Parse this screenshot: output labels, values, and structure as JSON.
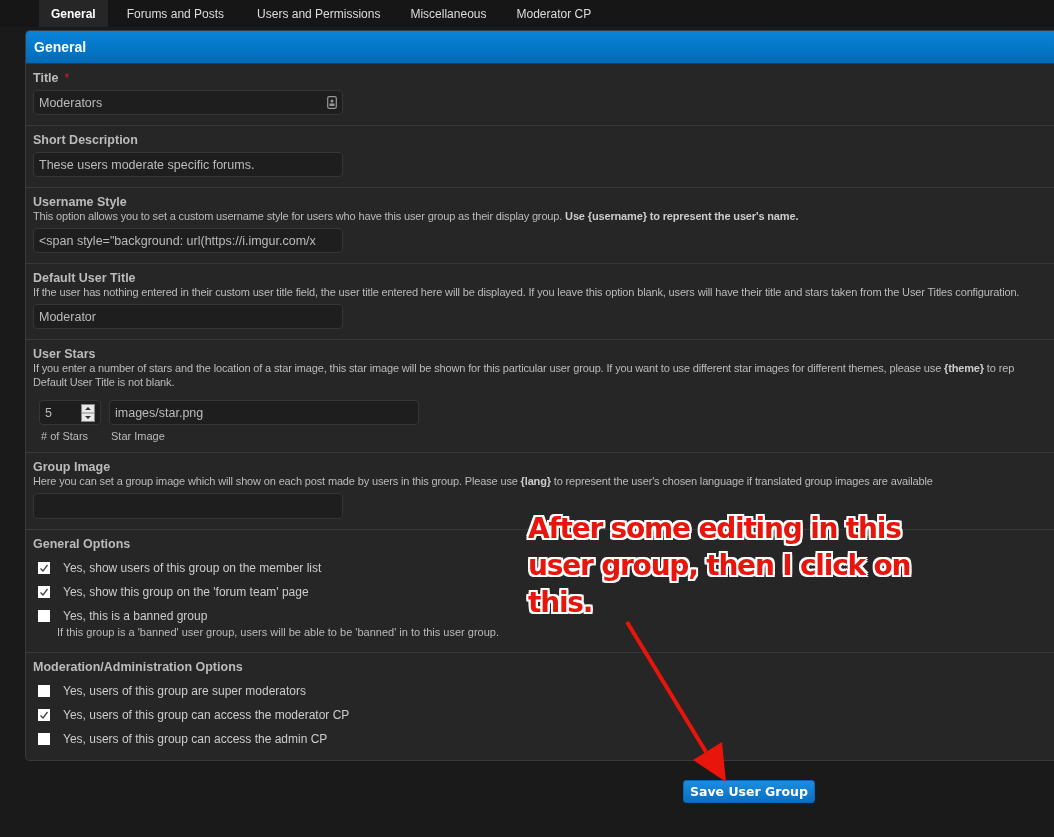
{
  "tabs": [
    {
      "label": "General",
      "selected": true
    },
    {
      "label": "Forums and Posts",
      "selected": false
    },
    {
      "label": "Users and Permissions",
      "selected": false
    },
    {
      "label": "Miscellaneous",
      "selected": false
    },
    {
      "label": "Moderator CP",
      "selected": false
    }
  ],
  "panel": {
    "title": "General",
    "rows": [
      {
        "kind": "text",
        "label": "Title",
        "required_mark": "*",
        "value": "Moderators",
        "field_icon": true
      },
      {
        "kind": "text",
        "label": "Short Description",
        "value": "These users moderate specific forums."
      },
      {
        "kind": "text",
        "label": "Username Style",
        "description": [
          "This option allows you to set a custom username style for users who have this user group as their display group. **Use {username} to represent the user's name.**"
        ],
        "value": "<span style=\"background: url(https://i.imgur.com/x"
      },
      {
        "kind": "text",
        "label": "Default User Title",
        "description": [
          "If the user has nothing entered in their custom user title field, the user title entered here will be displayed. If you leave this option blank, users will have their title and stars taken from the User Titles configuration."
        ],
        "value": "Moderator"
      },
      {
        "kind": "stars",
        "label": "User Stars",
        "description": [
          "If you enter a number of stars and the location of a star image, this star image will be shown for this particular user group. If you want to use different star images for different themes, please use **{theme}** to rep",
          "Default User Title is not blank."
        ],
        "count": "5",
        "count_label": "# of Stars",
        "image": "images/star.png",
        "image_label": "Star Image"
      },
      {
        "kind": "text",
        "label": "Group Image",
        "description": [
          "Here you can set a group image which will show on each post made by users in this group. Please use **{lang}** to represent the user's chosen language if translated group images are available"
        ]
      },
      {
        "kind": "checks",
        "label": "General Options",
        "options": [
          {
            "label": "Yes, show users of this group on the member list",
            "checked": true
          },
          {
            "label": "Yes, show this group on the 'forum team' page",
            "checked": true
          },
          {
            "label": "Yes, this is a banned group",
            "checked": false,
            "note": "If this group is a 'banned' user group, users will be able to be 'banned' in to this user group."
          }
        ]
      },
      {
        "kind": "checks",
        "label": "Moderation/Administration Options",
        "options": [
          {
            "label": "Yes, users of this group are super moderators",
            "checked": false
          },
          {
            "label": "Yes, users of this group can access the moderator CP",
            "checked": true
          },
          {
            "label": "Yes, users of this group can access the admin CP",
            "checked": false
          }
        ]
      }
    ]
  },
  "save_button": "Save User Group",
  "annotation": {
    "text": "After some editing in this user group, then I click on this.",
    "arrow": true
  }
}
